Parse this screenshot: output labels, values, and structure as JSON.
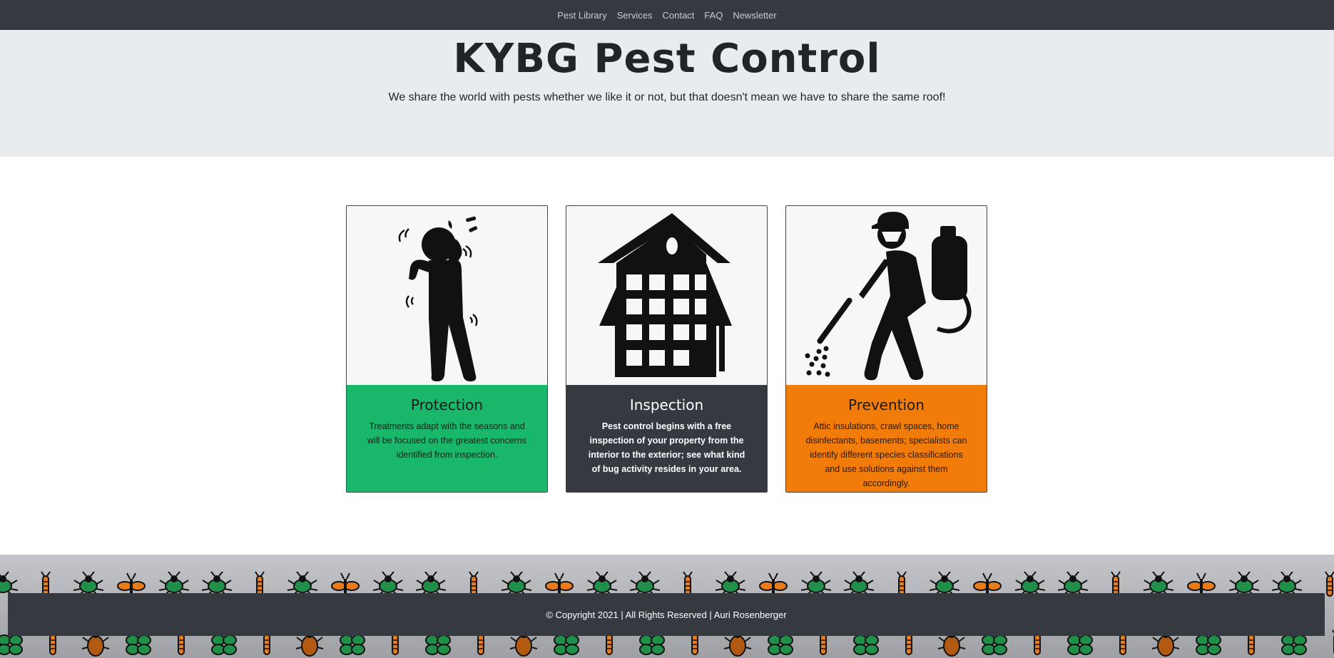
{
  "nav": {
    "items": [
      "Pest Library",
      "Services",
      "Contact",
      "FAQ",
      "Newsletter"
    ]
  },
  "hero": {
    "title": "KYBG Pest Control",
    "subtitle": "We share the world with pests whether we like it or not, but that doesn't mean we have to share the same roof!"
  },
  "cards": [
    {
      "title": "Protection",
      "text": "Treatments adapt with the seasons and will be focused on the greatest concerns identified from inspection.",
      "color": "#19b76a",
      "icon": "itchy-person-icon"
    },
    {
      "title": "Inspection",
      "text": "Pest control begins with a free inspection of your property from the interior to the exterior; see what kind of bug activity resides in your area.",
      "color": "#343a40",
      "icon": "house-icon"
    },
    {
      "title": "Prevention",
      "text": "Attic insulations, crawl spaces, home disinfectants, basements; specialists can identify different species classifications and use solutions against them accordingly.",
      "color": "#f27c0a",
      "icon": "exterminator-sprayer-icon"
    }
  ],
  "footer": {
    "copyright": "© Copyright 2021 | All Rights Reserved | Auri Rosenberger"
  }
}
